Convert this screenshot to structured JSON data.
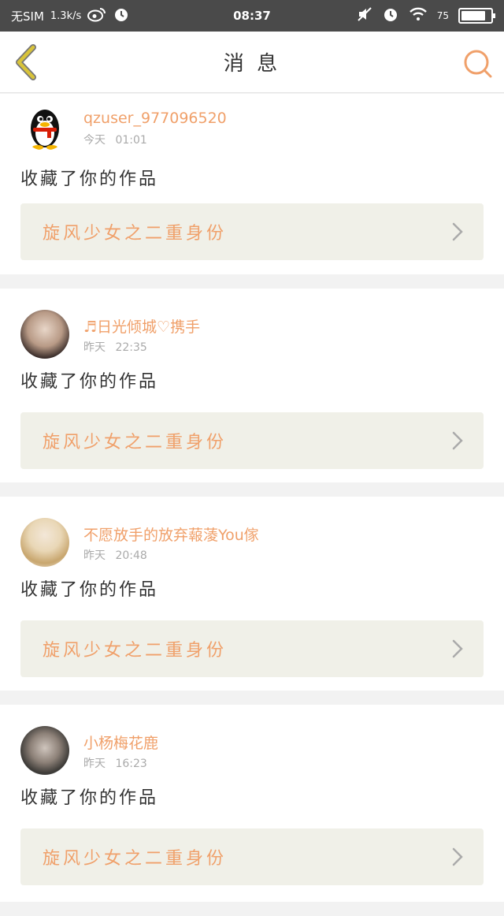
{
  "status_bar": {
    "carrier": "无SIM",
    "speed": "1.3k/s",
    "time": "08:37",
    "battery_text": "75",
    "battery_level": 0.75
  },
  "nav": {
    "title": "消 息"
  },
  "messages": [
    {
      "username": "qzuser_977096520",
      "day": "今天",
      "clock": "01:01",
      "action": "收藏了你的作品",
      "work": "旋风少女之二重身份"
    },
    {
      "username": "♬日光倾城♡携手",
      "day": "昨天",
      "clock": "22:35",
      "action": "收藏了你的作品",
      "work": "旋风少女之二重身份"
    },
    {
      "username": "不愿放手的放弃蕔蓤You傢",
      "day": "昨天",
      "clock": "20:48",
      "action": "收藏了你的作品",
      "work": "旋风少女之二重身份"
    },
    {
      "username": "小杨梅花鹿",
      "day": "昨天",
      "clock": "16:23",
      "action": "收藏了你的作品",
      "work": "旋风少女之二重身份"
    }
  ],
  "colors": {
    "accent": "#f0a06a",
    "status_bar": "#4a4a4a",
    "back_arrow": "#d8c33a",
    "link_bg": "#f0f0e8"
  }
}
